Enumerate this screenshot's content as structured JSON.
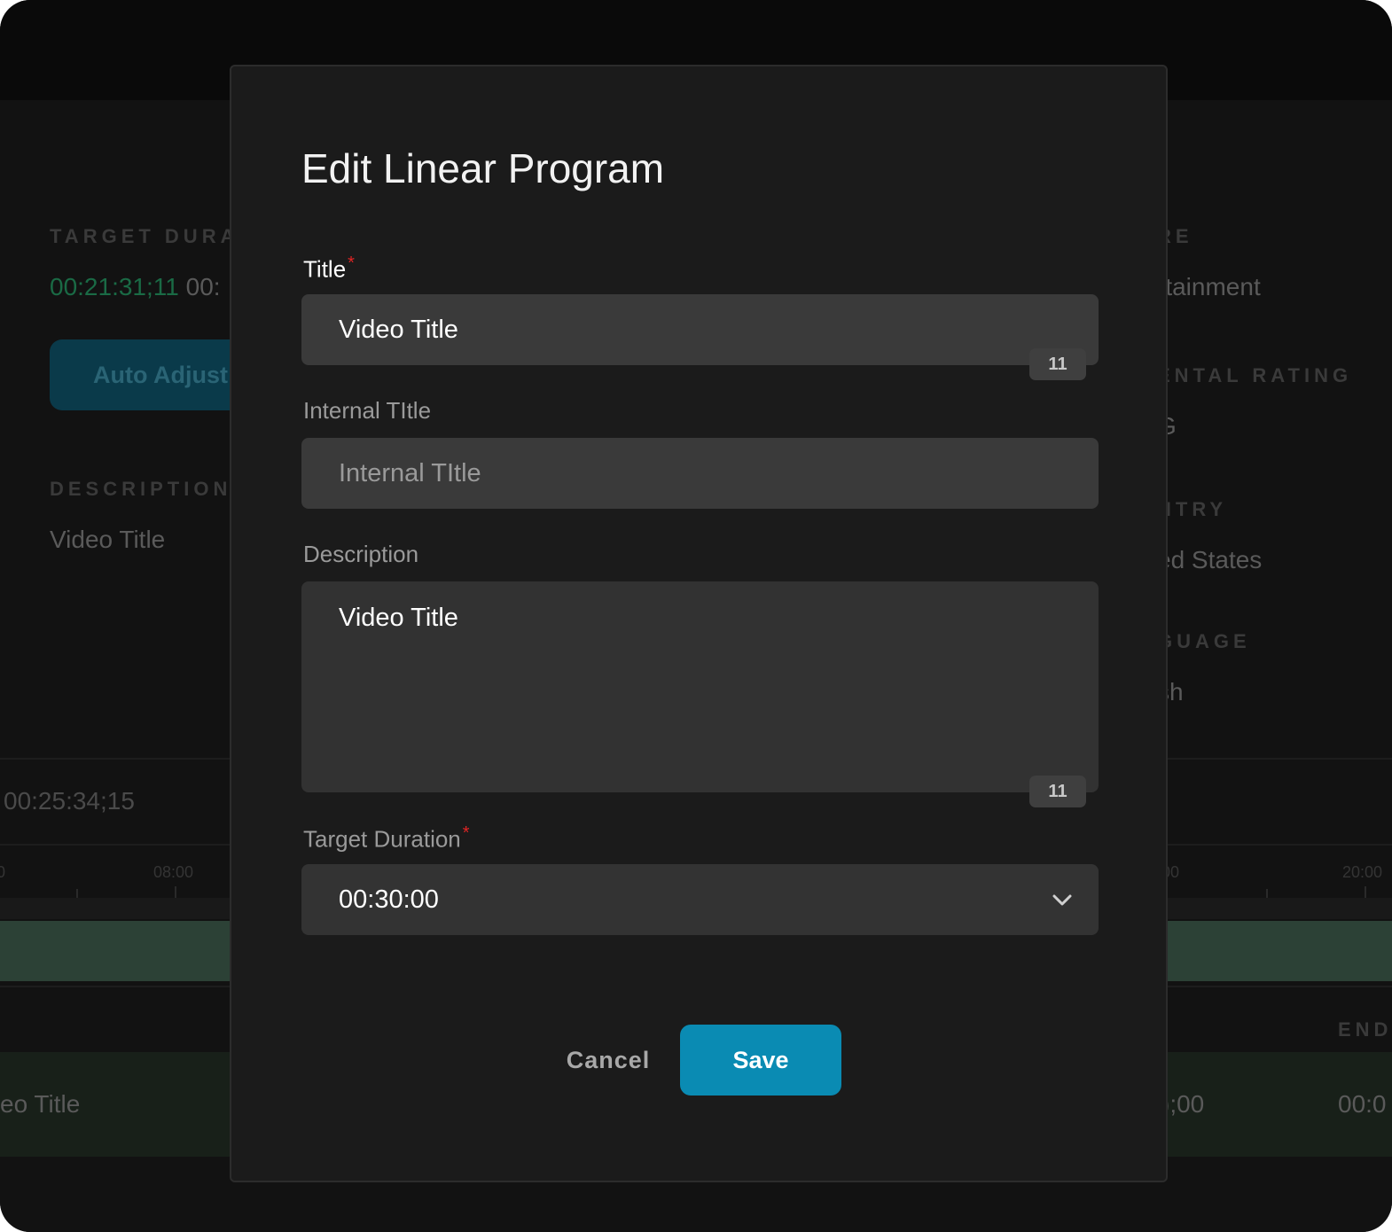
{
  "background": {
    "left": {
      "target_duration_label": "TARGET DURA",
      "target_duration_value_green": "00:21:31;11",
      "target_duration_value_rest": "00:",
      "auto_adjust_button": "Auto Adjust",
      "description_label": "DESCRIPTION",
      "description_value": "Video Title",
      "timecode": "00:25:34;15",
      "ruler_left_partial": "0",
      "ruler_tick_1": "08:00",
      "row_title_partial": "eo Title"
    },
    "right": {
      "genre_label_partial": "RE",
      "genre_value_partial": "rtainment",
      "parental_rating_label_partial": "ENTAL RATING",
      "parental_rating_value_partial": "G",
      "country_label_partial": "NTRY",
      "country_value_partial": "ed States",
      "language_label_partial": "GUAGE",
      "language_value_partial": "sh",
      "ruler_tick_partial": "00",
      "ruler_tick_2": "20:00",
      "end_label_partial": "END",
      "row_start_partial": ");00",
      "row_end_partial": "00:0"
    }
  },
  "modal": {
    "title": "Edit Linear Program",
    "fields": {
      "title": {
        "label": "Title",
        "required_mark": "*",
        "value": "Video Title",
        "counter": "11"
      },
      "internal_title": {
        "label": "Internal TItle",
        "placeholder": "Internal TItle"
      },
      "description": {
        "label": "Description",
        "value": "Video Title",
        "counter": "11"
      },
      "target_duration": {
        "label": "Target Duration",
        "required_mark": "*",
        "value": "00:30:00",
        "icon": "chevron-down-icon"
      }
    },
    "actions": {
      "cancel_label": "Cancel",
      "save_label": "Save"
    }
  },
  "colors": {
    "accent": "#0a8bb3",
    "required": "#e02424",
    "timecode_green": "#1a6a45"
  }
}
